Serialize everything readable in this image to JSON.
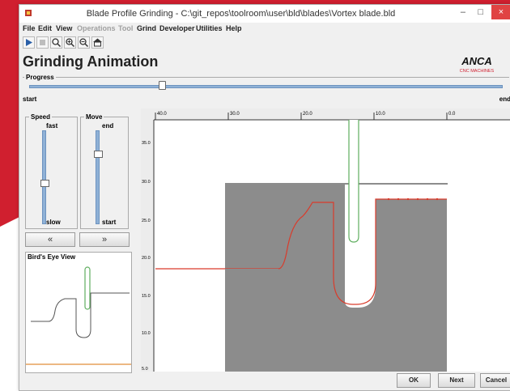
{
  "window": {
    "title": "Blade Profile Grinding - C:\\git_repos\\toolroom\\user\\bld\\blades\\Vortex blade.bld",
    "minimize": "–",
    "maximize": "□",
    "close": "×"
  },
  "menu": {
    "items": [
      {
        "label": "File",
        "enabled": true
      },
      {
        "label": "Edit",
        "enabled": true
      },
      {
        "label": "View",
        "enabled": true
      },
      {
        "label": "Operations",
        "enabled": false
      },
      {
        "label": "Tool",
        "enabled": false
      },
      {
        "label": "Grind",
        "enabled": true
      },
      {
        "label": "Developer",
        "enabled": true
      },
      {
        "label": "Utilities",
        "enabled": true
      },
      {
        "label": "Help",
        "enabled": true
      }
    ]
  },
  "toolbar": {
    "icons": [
      "play-icon",
      "stop-icon",
      "zoom-fit-icon",
      "zoom-in-icon",
      "zoom-out-icon",
      "home-view-icon"
    ]
  },
  "page": {
    "heading": "Grinding Animation",
    "logo": {
      "brand": "ANCA",
      "sub": "CNC MACHINES",
      "color": "#d01f2f"
    }
  },
  "progress": {
    "label": "Progress",
    "start_label": "start",
    "end_label": "end",
    "value": 0.28
  },
  "speed": {
    "label": "Speed",
    "top": "fast",
    "bottom": "slow",
    "value": 0.43
  },
  "move": {
    "label": "Move",
    "top": "end",
    "bottom": "start",
    "value": 0.75
  },
  "nav": {
    "back": "«",
    "forward": "»"
  },
  "birds_eye": {
    "label": "Bird's Eye View"
  },
  "ruler": {
    "x_ticks": [
      "40.0",
      "30.0",
      "20.0",
      "10.0",
      "0.0"
    ],
    "y_ticks": [
      "35.0",
      "30.0",
      "25.0",
      "20.0",
      "15.0",
      "10.0",
      "5.0"
    ]
  },
  "buttons": {
    "ok": "OK",
    "next": "Next",
    "cancel": "Cancel"
  },
  "colors": {
    "accent_red": "#d01f2f",
    "block_gray": "#8c8c8c",
    "profile_red": "#d93b2b",
    "wheel_green": "#5fae5f",
    "slider_blue": "#8fb1d6"
  }
}
